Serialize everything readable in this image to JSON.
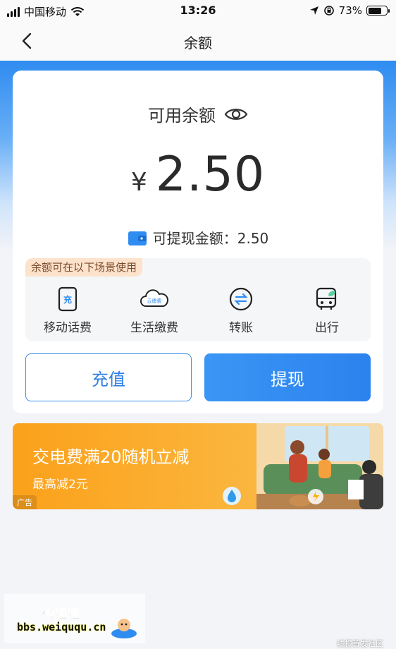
{
  "status_bar": {
    "carrier": "中国移动",
    "time": "13:26",
    "battery_percent": "73%",
    "battery_level": 0.73
  },
  "nav": {
    "title": "余额",
    "back_icon": "chevron-left-icon"
  },
  "balance": {
    "label": "可用余额",
    "eye_icon": "eye-icon",
    "currency": "¥",
    "amount": "2.50",
    "withdrawable_label": "可提现金额：2.50",
    "wallet_icon": "wallet-icon"
  },
  "scenes": {
    "tag": "余额可在以下场景使用",
    "items": [
      {
        "label": "移动话费",
        "icon": "phone-recharge-icon",
        "icon_text": "充"
      },
      {
        "label": "生活缴费",
        "icon": "cloud-bill-icon",
        "icon_text": "云缴费"
      },
      {
        "label": "转账",
        "icon": "transfer-icon"
      },
      {
        "label": "出行",
        "icon": "bus-icon"
      }
    ]
  },
  "actions": {
    "recharge_label": "充值",
    "withdraw_label": "提现"
  },
  "promo": {
    "title": "交电费满20随机立减",
    "subtitle": "最高减2元",
    "ad_tag": "广告"
  },
  "watermark": {
    "brand": "微趣趣",
    "url": "bbs.weiququ.cn",
    "right_text": "线报首发社区"
  },
  "colors": {
    "primary": "#2f8cf0",
    "promo_orange": "#fba11b",
    "tag_bg": "#fde2cc"
  }
}
